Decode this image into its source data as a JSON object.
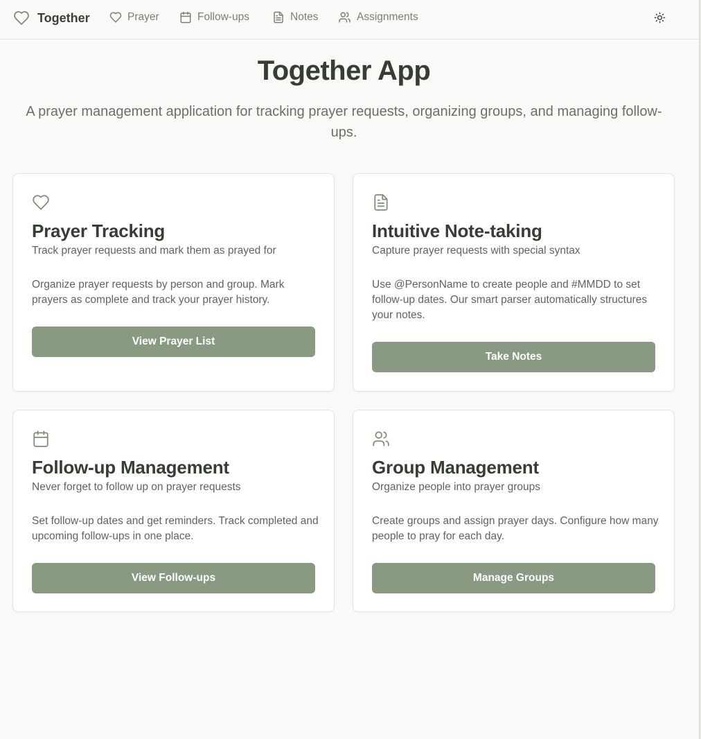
{
  "colors": {
    "accent": "#8a9a82",
    "icon": "#7d8c76",
    "heading": "#363d33",
    "muted_text": "#5e655a",
    "background": "#f9f9f7"
  },
  "nav": {
    "brand": {
      "icon": "heart-icon",
      "label": "Together"
    },
    "items": [
      {
        "icon": "heart-icon",
        "label": "Prayer"
      },
      {
        "icon": "calendar-icon",
        "label": "Follow-ups"
      },
      {
        "icon": "file-text-icon",
        "label": "Notes"
      },
      {
        "icon": "users-icon",
        "label": "Assignments"
      }
    ],
    "theme_toggle_icon": "sun-icon"
  },
  "hero": {
    "title": "Together App",
    "subtitle": "A prayer management application for tracking prayer requests, organizing groups, and managing follow-ups."
  },
  "cards": [
    {
      "icon": "heart-icon",
      "title": "Prayer Tracking",
      "subtitle": "Track prayer requests and mark them as prayed for",
      "body": "Organize prayer requests by person and group. Mark prayers as complete and track your prayer history.",
      "button": "View Prayer List"
    },
    {
      "icon": "file-text-icon",
      "title": "Intuitive Note-taking",
      "subtitle": "Capture prayer requests with special syntax",
      "body": "Use @PersonName to create people and #MMDD to set follow-up dates. Our smart parser automatically structures your notes.",
      "button": "Take Notes"
    },
    {
      "icon": "calendar-icon",
      "title": "Follow-up Management",
      "subtitle": "Never forget to follow up on prayer requests",
      "body": "Set follow-up dates and get reminders. Track completed and upcoming follow-ups in one place.",
      "button": "View Follow-ups"
    },
    {
      "icon": "users-icon",
      "title": "Group Management",
      "subtitle": "Organize people into prayer groups",
      "body": "Create groups and assign prayer days. Configure how many people to pray for each day.",
      "button": "Manage Groups"
    }
  ]
}
